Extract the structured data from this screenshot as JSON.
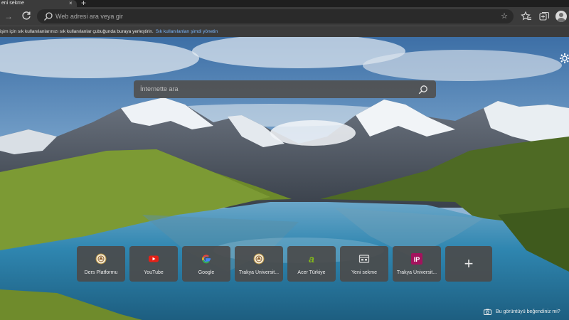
{
  "tabs": [
    {
      "title": "eni sekme",
      "close": "×"
    }
  ],
  "new_tab_symbol": "+",
  "toolbar": {
    "forward": "→",
    "address_placeholder": "Web adresi ara veya gir",
    "favorite_star": "☆"
  },
  "favorites_bar": {
    "message": "işim için sık kullanılanlarınızı sık kullanılanlar çubuğunda buraya yerleştirin.",
    "manage_link": "Sık kullanılanları şimdi yönetin"
  },
  "search": {
    "placeholder": "İnternette ara"
  },
  "quick_links": [
    {
      "label": "Ders Platformu",
      "icon": "seal-icon"
    },
    {
      "label": "YouTube",
      "icon": "youtube-icon"
    },
    {
      "label": "Google",
      "icon": "google-icon"
    },
    {
      "label": "Trakya Üniversit...",
      "icon": "seal-icon"
    },
    {
      "label": "Acer Türkiye",
      "icon": "acer-icon"
    },
    {
      "label": "Yeni sekme",
      "icon": "new-tab-icon"
    },
    {
      "label": "Trakya Üniversit...",
      "icon": "ip-icon",
      "badge": "IP"
    }
  ],
  "add_tile_symbol": "+",
  "image_prompt": "Bu görüntüyü beğendiniz mi?",
  "colors": {
    "accent_link": "#7cb8ff",
    "toolbar": "#3b3b3b",
    "youtube_red": "#e62117",
    "acer_green": "#83b81a",
    "ip_badge": "#a3135d"
  }
}
